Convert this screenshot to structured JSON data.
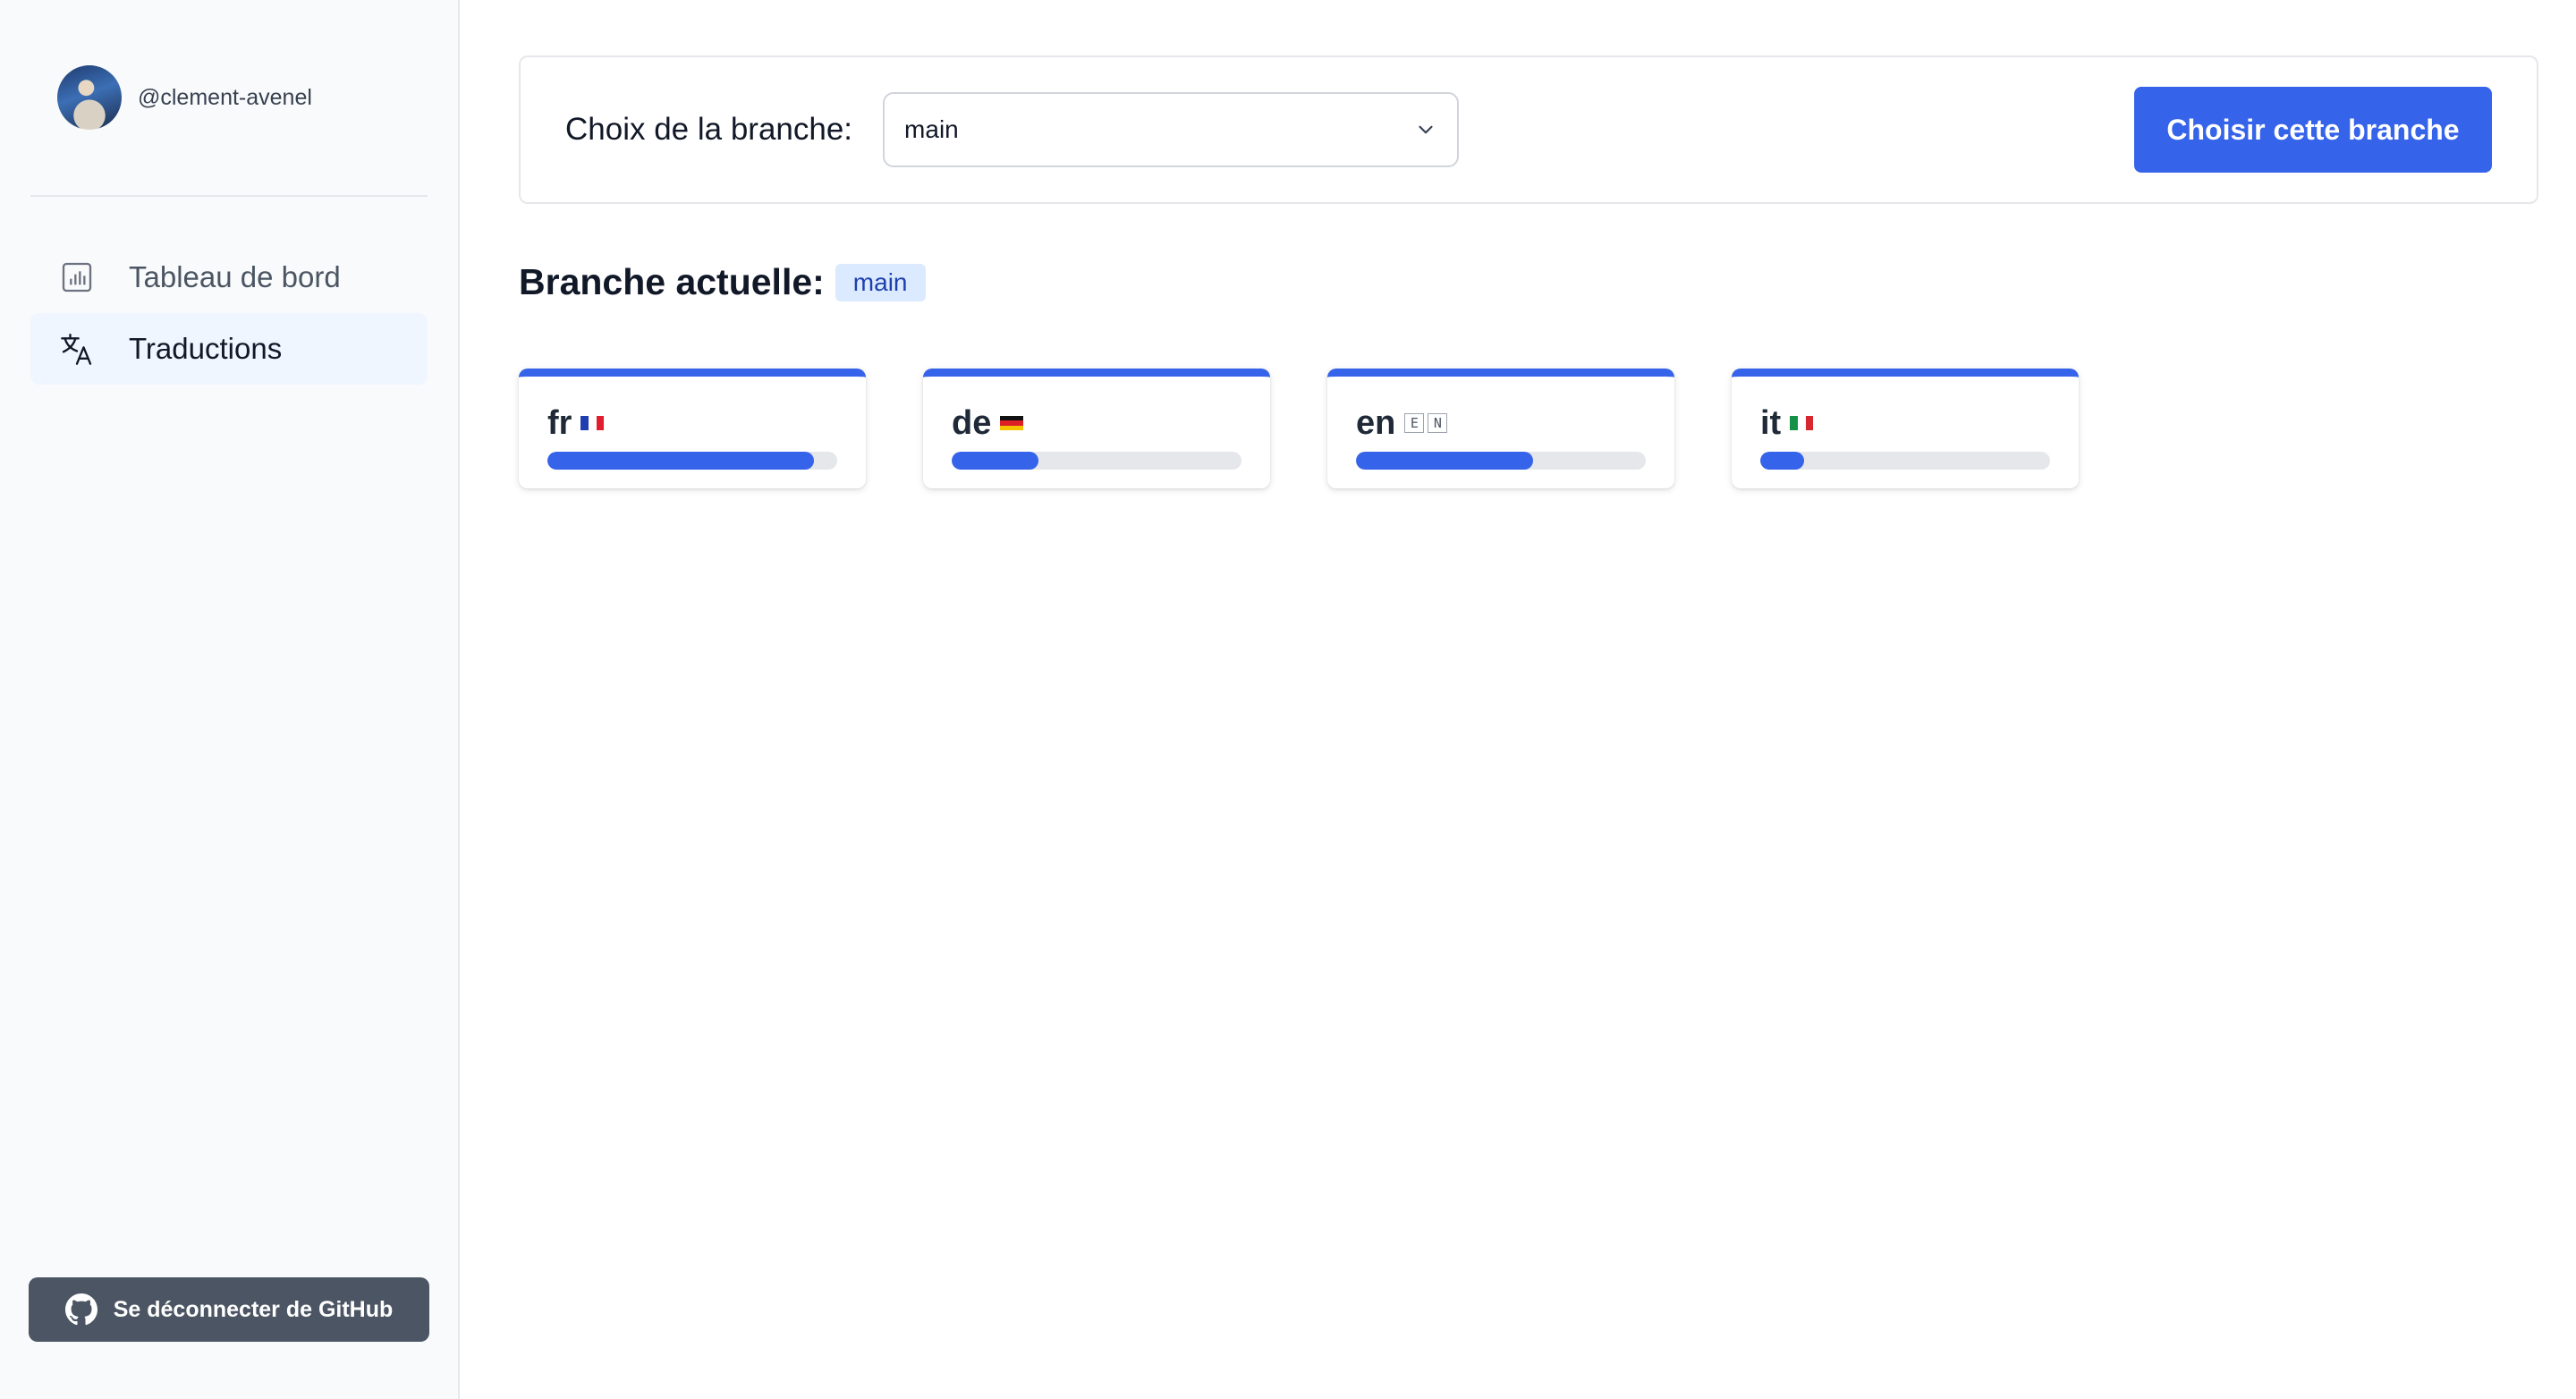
{
  "user": {
    "handle": "@clement-avenel"
  },
  "nav": {
    "items": [
      {
        "label": "Tableau de bord",
        "icon": "bar-chart-icon",
        "active": false
      },
      {
        "label": "Traductions",
        "icon": "translate-icon",
        "active": true
      }
    ]
  },
  "logout": {
    "label": "Se déconnecter de GitHub",
    "icon": "github-icon"
  },
  "branch": {
    "label": "Choix de la branche:",
    "selected": "main",
    "choose_label": "Choisir cette branche"
  },
  "current": {
    "label": "Branche actuelle:",
    "branch": "main"
  },
  "languages": [
    {
      "code": "fr",
      "flag": "fr",
      "progress": 0.92
    },
    {
      "code": "de",
      "flag": "de",
      "progress": 0.3
    },
    {
      "code": "en",
      "flag": "en",
      "flag_text": [
        "E",
        "N"
      ],
      "progress": 0.61
    },
    {
      "code": "it",
      "flag": "it",
      "progress": 0.15
    }
  ],
  "colors": {
    "accent": "#3563e9",
    "badge_bg": "#dbeafe",
    "badge_text": "#1e40af",
    "logout_bg": "#4b5563"
  }
}
